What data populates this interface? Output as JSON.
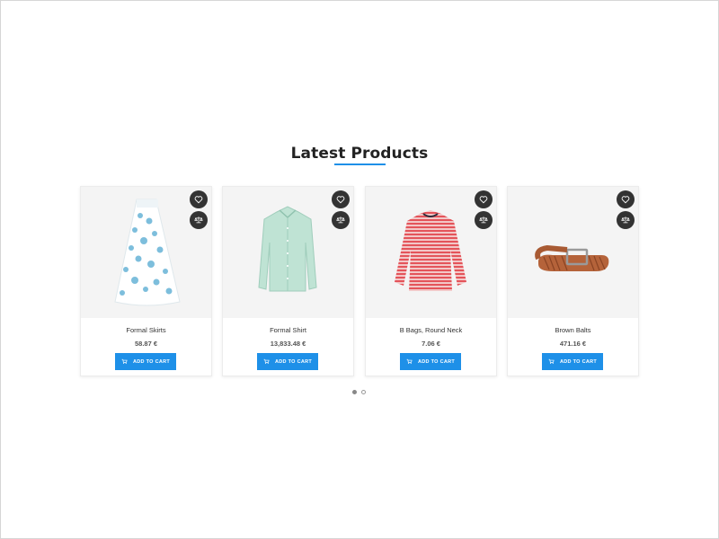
{
  "section": {
    "title": "Latest Products"
  },
  "products": [
    {
      "name": "Formal Skirts",
      "price": "58.87 €",
      "cart_label": "ADD TO CART",
      "image": "skirt"
    },
    {
      "name": "Formal Shirt",
      "price": "13,833.48 €",
      "cart_label": "ADD TO CART",
      "image": "shirt"
    },
    {
      "name": "B Bags, Round Neck",
      "price": "7.06 €",
      "cart_label": "ADD TO CART",
      "image": "striped-top"
    },
    {
      "name": "Brown Balts",
      "price": "471.16 €",
      "cart_label": "ADD TO CART",
      "image": "belt"
    }
  ],
  "icons": {
    "wishlist": "heart-icon",
    "compare": "scale-icon",
    "cart": "cart-icon"
  },
  "colors": {
    "accent": "#1e90e8",
    "icon_bg": "#333333",
    "media_bg": "#f4f4f4"
  },
  "carousel": {
    "pages": 2,
    "active": 1
  }
}
